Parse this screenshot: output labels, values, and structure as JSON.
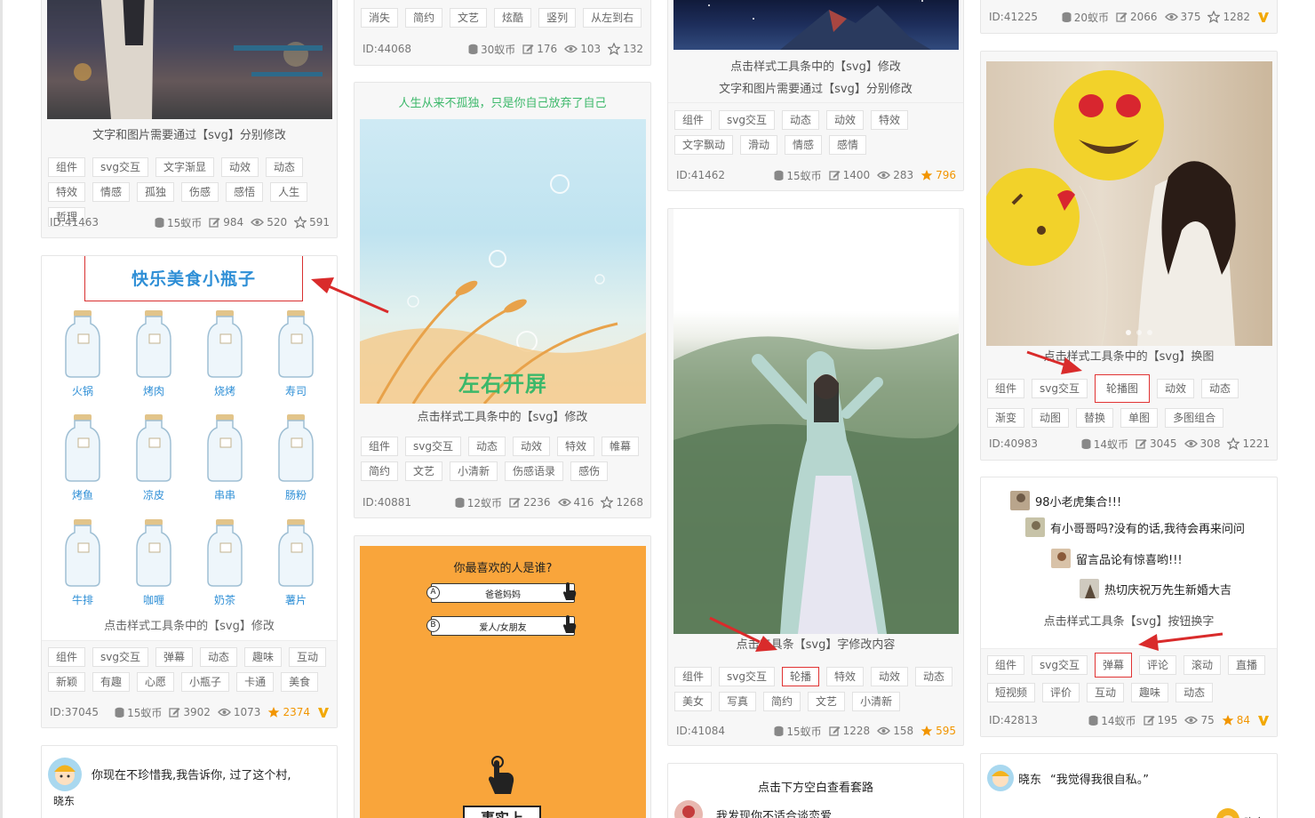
{
  "colors": {
    "accent": "#f29500",
    "highlight": "#e13333",
    "link": "#2f8fd6"
  },
  "col1": {
    "card_a": {
      "caption": "文字和图片需要通过【svg】分别修改",
      "tags": [
        "组件",
        "svg交互",
        "文字渐显",
        "动效",
        "动态",
        "特效",
        "情感",
        "孤独",
        "伤感",
        "感悟",
        "人生",
        "哲理"
      ],
      "id": "ID:41463",
      "coins": "15蚁币",
      "edits": "984",
      "views": "520",
      "favs": "591"
    },
    "card_b": {
      "banner_title": "快乐美食小瓶子",
      "jars": [
        "火锅",
        "烤肉",
        "烧烤",
        "寿司",
        "烤鱼",
        "凉皮",
        "串串",
        "肠粉",
        "牛排",
        "咖喱",
        "奶茶",
        "薯片"
      ],
      "caption": "点击样式工具条中的【svg】修改",
      "tags": [
        "组件",
        "svg交互",
        "弹幕",
        "动态",
        "趣味",
        "互动",
        "新颖",
        "有趣",
        "心愿",
        "小瓶子",
        "卡通",
        "美食"
      ],
      "id": "ID:37045",
      "coins": "15蚁币",
      "edits": "3902",
      "views": "1073",
      "favs": "2374"
    },
    "card_c": {
      "text": "你现在不珍惜我,我告诉你, 过了这个村,",
      "name": "晓东"
    }
  },
  "col2": {
    "card_a": {
      "tags": [
        "消失",
        "简约",
        "文艺",
        "炫酷",
        "竖列",
        "从左到右"
      ],
      "id": "ID:44068",
      "coins": "30蚁币",
      "edits": "176",
      "views": "103",
      "favs": "132"
    },
    "card_b": {
      "top_text": "人生从来不孤独，只是你自己放弃了自己",
      "overlay": "左右开屏",
      "caption": "点击样式工具条中的【svg】修改",
      "tags": [
        "组件",
        "svg交互",
        "动态",
        "动效",
        "特效",
        "帷幕",
        "简约",
        "文艺",
        "小清新",
        "伤感语录",
        "感伤"
      ],
      "id": "ID:40881",
      "coins": "12蚁币",
      "edits": "2236",
      "views": "416",
      "favs": "1268"
    },
    "card_c": {
      "question": "你最喜欢的人是谁?",
      "opt_a_letter": "A",
      "opt_a": "爸爸妈妈",
      "opt_b_letter": "B",
      "opt_b": "爱人/女朋友",
      "bottom_btn": "事实上"
    }
  },
  "col3": {
    "card_a": {
      "caption_1": "点击样式工具条中的【svg】修改",
      "caption_2": "文字和图片需要通过【svg】分别修改",
      "tags": [
        "组件",
        "svg交互",
        "动态",
        "动效",
        "特效",
        "文字飘动",
        "滑动",
        "情感",
        "感情"
      ],
      "id": "ID:41462",
      "coins": "15蚁币",
      "edits": "1400",
      "views": "283",
      "favs": "796"
    },
    "card_b": {
      "caption": "点击工具条【svg】字修改内容",
      "tags": [
        "组件",
        "svg交互",
        "轮播",
        "特效",
        "动效",
        "动态",
        "美女",
        "写真",
        "简约",
        "文艺",
        "小清新"
      ],
      "id": "ID:41084",
      "coins": "15蚁币",
      "edits": "1228",
      "views": "158",
      "favs": "595"
    },
    "card_c": {
      "title": "点击下方空白查看套路",
      "text": "我发现你不适合谈恋爱,"
    }
  },
  "col4": {
    "card_a": {
      "id": "ID:41225",
      "coins": "20蚁币",
      "edits": "2066",
      "views": "375",
      "favs": "1282"
    },
    "card_b": {
      "caption": "点击样式工具条中的【svg】换图",
      "tags": [
        "组件",
        "svg交互",
        "轮播图",
        "动效",
        "动态",
        "渐变",
        "动图",
        "替换",
        "单图",
        "多图组合"
      ],
      "id": "ID:40983",
      "coins": "14蚁币",
      "edits": "3045",
      "views": "308",
      "favs": "1221"
    },
    "card_c": {
      "comments": [
        "98小老虎集合!!!",
        "有小哥哥吗?没有的话,我待会再来问问",
        "留言品论有惊喜哟!!!",
        "热切庆祝万先生新婚大吉"
      ],
      "caption": "点击样式工具条【svg】按钮换字",
      "tags": [
        "组件",
        "svg交互",
        "弹幕",
        "评论",
        "滚动",
        "直播",
        "短视频",
        "评价",
        "互动",
        "趣味",
        "动态"
      ],
      "id": "ID:42813",
      "coins": "14蚁币",
      "edits": "195",
      "views": "75",
      "favs": "84"
    },
    "card_d": {
      "name": "晓东",
      "quote": "“我觉得我很自私。”",
      "corner": "晓东"
    }
  }
}
